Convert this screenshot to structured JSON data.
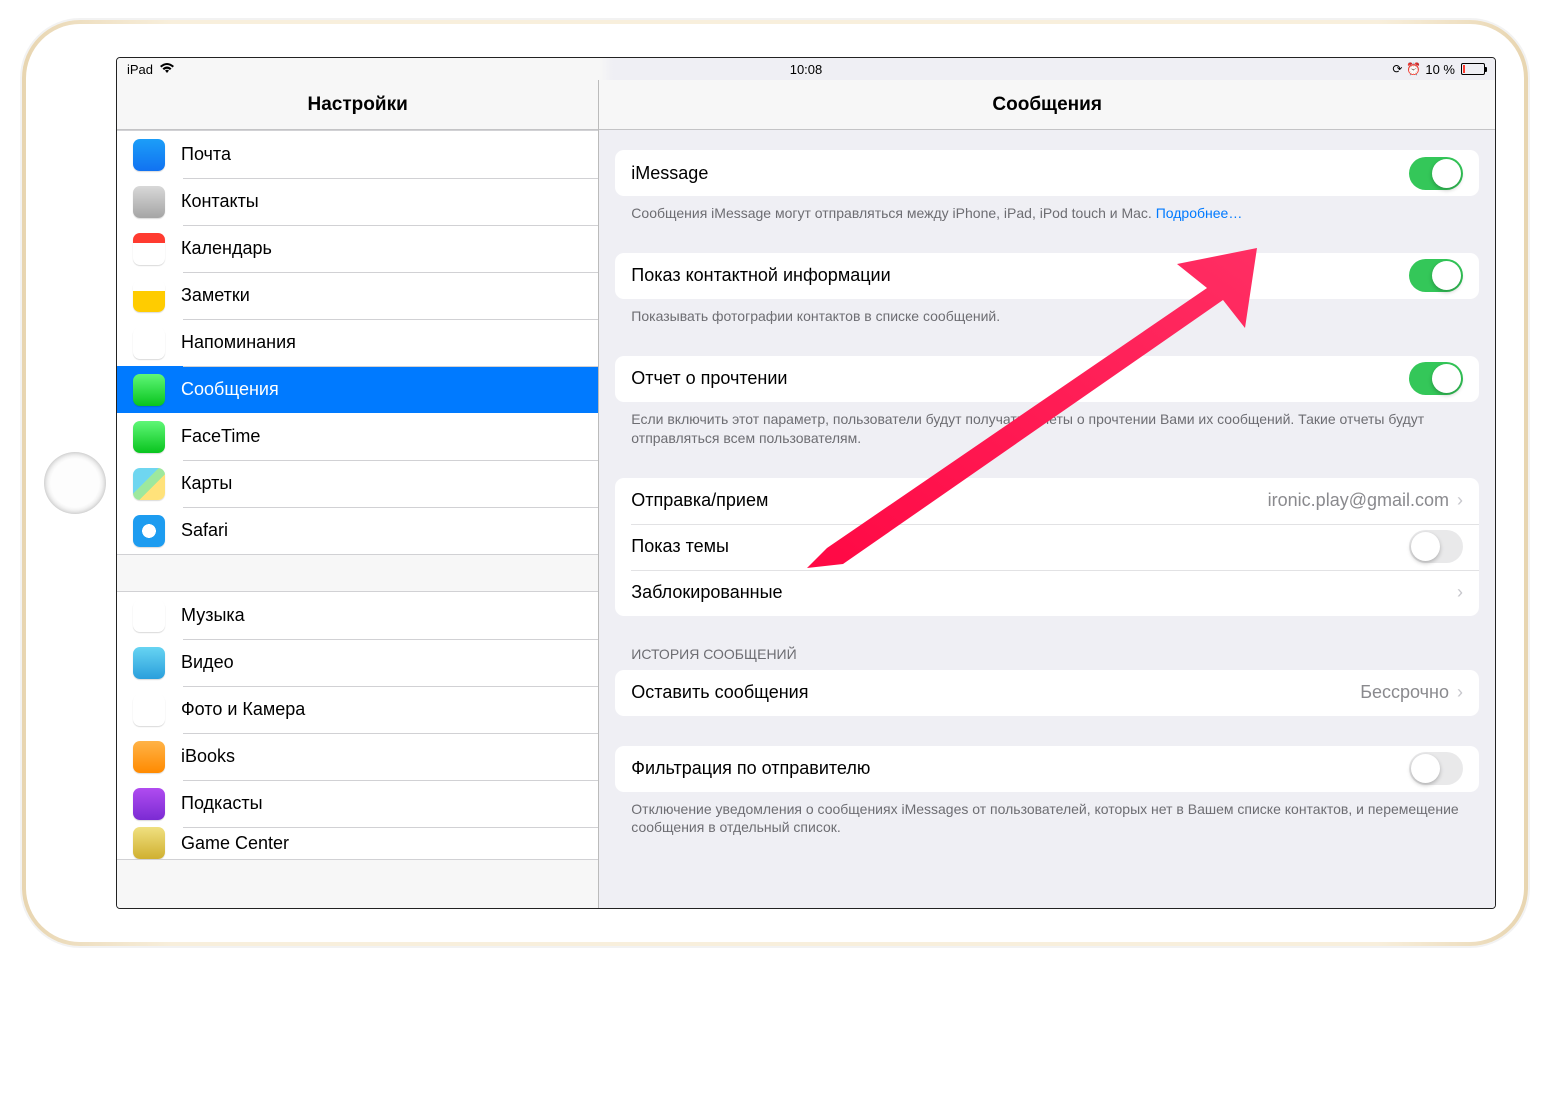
{
  "status": {
    "device": "iPad",
    "time": "10:08",
    "battery_text": "10 %",
    "battery_percent": 10
  },
  "sidebar": {
    "title": "Настройки",
    "groups": [
      {
        "items": [
          {
            "key": "mail",
            "label": "Почта",
            "icon": "ic-mail"
          },
          {
            "key": "contacts",
            "label": "Контакты",
            "icon": "ic-contacts"
          },
          {
            "key": "calendar",
            "label": "Календарь",
            "icon": "ic-calendar"
          },
          {
            "key": "notes",
            "label": "Заметки",
            "icon": "ic-notes"
          },
          {
            "key": "reminders",
            "label": "Напоминания",
            "icon": "ic-reminders"
          },
          {
            "key": "messages",
            "label": "Сообщения",
            "icon": "ic-messages",
            "selected": true
          },
          {
            "key": "facetime",
            "label": "FaceTime",
            "icon": "ic-facetime"
          },
          {
            "key": "maps",
            "label": "Карты",
            "icon": "ic-maps"
          },
          {
            "key": "safari",
            "label": "Safari",
            "icon": "ic-safari"
          }
        ]
      },
      {
        "items": [
          {
            "key": "music",
            "label": "Музыка",
            "icon": "ic-music"
          },
          {
            "key": "videos",
            "label": "Видео",
            "icon": "ic-videos"
          },
          {
            "key": "photos",
            "label": "Фото и Камера",
            "icon": "ic-photos"
          },
          {
            "key": "ibooks",
            "label": "iBooks",
            "icon": "ic-ibooks"
          },
          {
            "key": "podcasts",
            "label": "Подкасты",
            "icon": "ic-podcasts"
          },
          {
            "key": "gamecenter",
            "label": "Game Center",
            "icon": "ic-gc",
            "partial": true
          }
        ]
      }
    ]
  },
  "main": {
    "title": "Сообщения",
    "imessage": {
      "label": "iMessage",
      "on": true,
      "footer": "Сообщения iMessage могут отправляться между iPhone, iPad, iPod touch и Mac.",
      "more": "Подробнее…"
    },
    "contactinfo": {
      "label": "Показ контактной информации",
      "on": true,
      "footer": "Показывать фотографии контактов в списке сообщений."
    },
    "readreceipt": {
      "label": "Отчет о прочтении",
      "on": true,
      "footer": "Если включить этот параметр, пользователи будут получать отчеты о прочтении Вами их сообщений. Такие отчеты будут отправляться всем пользователям."
    },
    "sendreceive": {
      "label": "Отправка/прием",
      "value": "ironic.play@gmail.com"
    },
    "subject": {
      "label": "Показ темы",
      "on": false
    },
    "blocked": {
      "label": "Заблокированные"
    },
    "history_header": "ИСТОРИЯ СООБЩЕНИЙ",
    "keep": {
      "label": "Оставить сообщения",
      "value": "Бессрочно"
    },
    "filter": {
      "label": "Фильтрация по отправителю",
      "on": false,
      "footer": "Отключение уведомления о сообщениях iMessages от пользователей, которых нет в Вашем списке контактов, и перемещение сообщения в отдельный список."
    }
  }
}
